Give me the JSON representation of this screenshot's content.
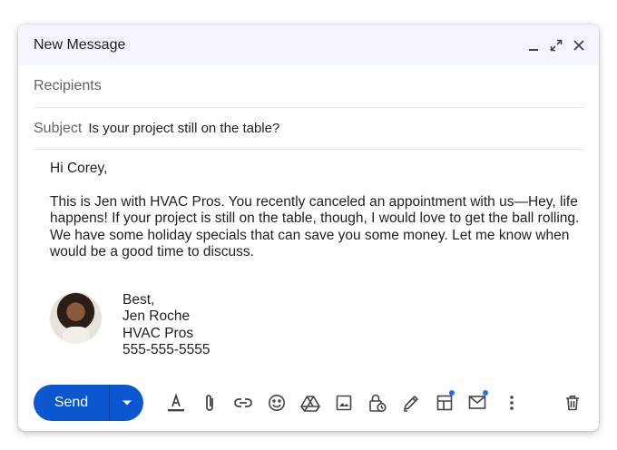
{
  "window": {
    "title": "New Message"
  },
  "fields": {
    "recipients_placeholder": "Recipients",
    "subject_label": "Subject",
    "subject_value": "Is your project still on the table?"
  },
  "body": {
    "greeting": "Hi Corey,",
    "paragraph": "This is Jen with HVAC Pros. You recently canceled an appointment with us—Hey, life happens! If your project is still on the table, though, I would love to get the ball rolling. We have some holiday specials that can save you some money. Let me know when would be a good time to discuss."
  },
  "signature": {
    "lines": [
      "Best,",
      "Jen Roche",
      "HVAC Pros",
      "555-555-5555"
    ]
  },
  "toolbar": {
    "send_label": "Send",
    "icons": [
      "text-format-icon",
      "attach-icon",
      "link-icon",
      "emoji-icon",
      "drive-icon",
      "photo-icon",
      "confidential-mode-icon",
      "signature-pen-icon",
      "layouts-icon",
      "email-templates-icon",
      "more-options-icon",
      "delete-icon"
    ]
  },
  "colors": {
    "accent": "#0b57d0",
    "header_bg": "#f2f6fc",
    "notification_dot": "#1a73e8"
  }
}
